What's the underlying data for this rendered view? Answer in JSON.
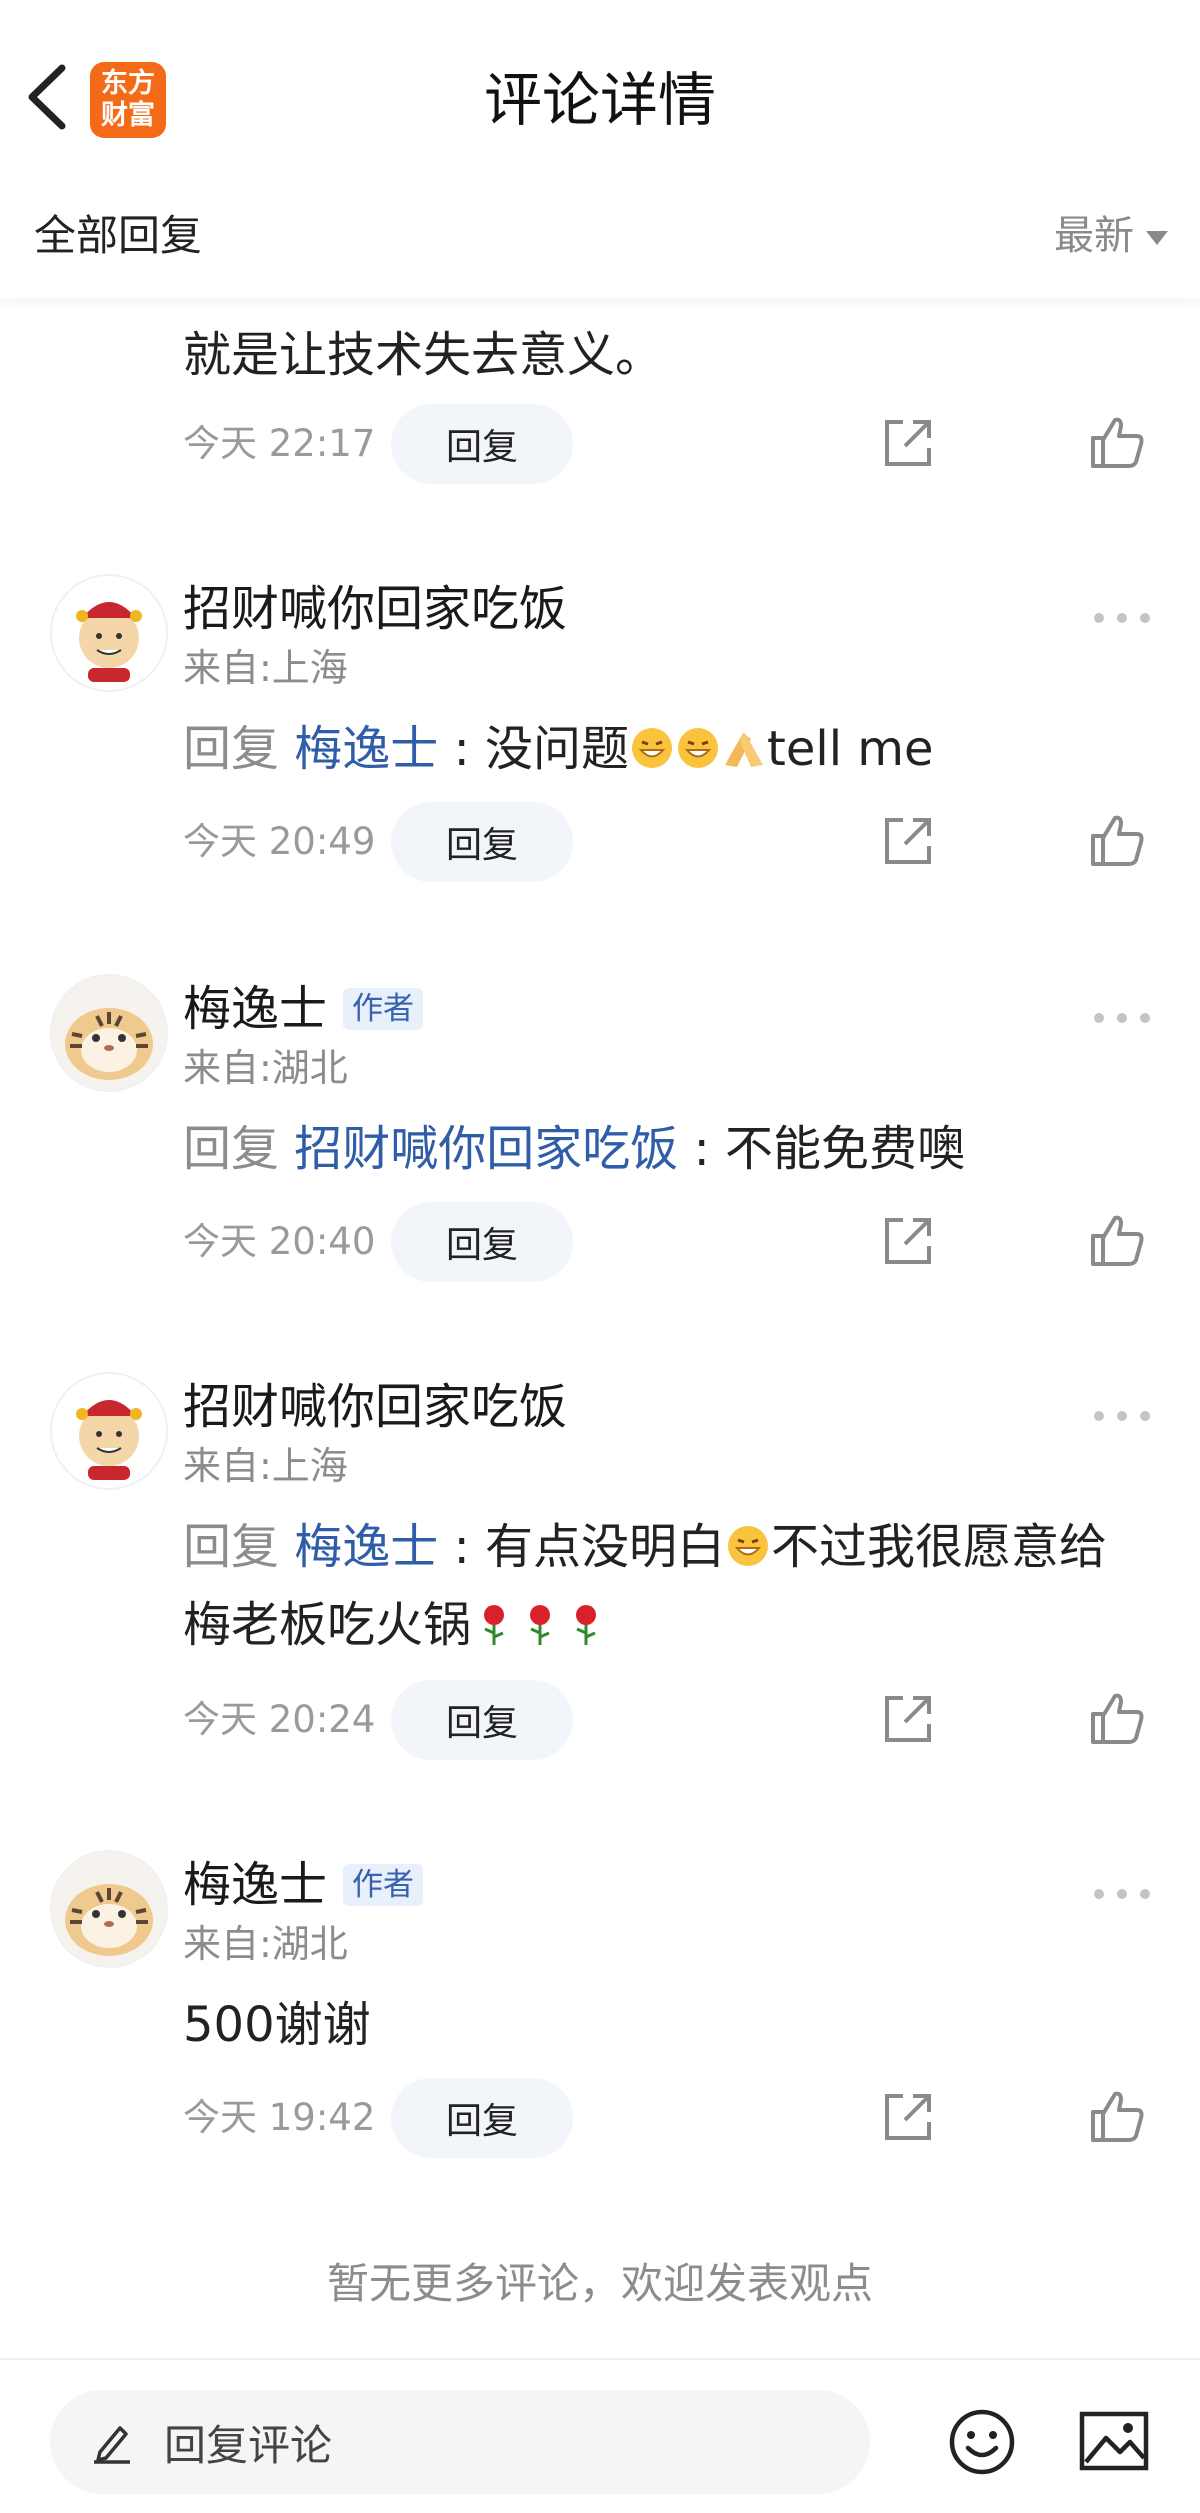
{
  "header": {
    "title": "评论详情",
    "logo_line1": "东方",
    "logo_line2": "财富"
  },
  "sortbar": {
    "label": "全部回复",
    "sort": "最新"
  },
  "partial_comment": {
    "text": "就是让技术失去意义。",
    "time": "今天 22:17",
    "reply": "回复"
  },
  "comments": [
    {
      "name": "招财喊你回家吃饭",
      "location": "来自:上海",
      "reply_prefix": "回复",
      "mention": "梅逸士",
      "text": ": 没问题",
      "text_after": "tell me",
      "time": "今天 20:49",
      "reply": "回复"
    },
    {
      "name": "梅逸士",
      "badge": "作者",
      "location": "来自:湖北",
      "reply_prefix": "回复",
      "mention": "招财喊你回家吃饭",
      "text": ": 不能免费噢",
      "time": "今天 20:40",
      "reply": "回复"
    },
    {
      "name": "招财喊你回家吃饭",
      "location": "来自:上海",
      "reply_prefix": "回复",
      "mention": "梅逸士",
      "text": ": 有点没明白",
      "text_mid": "不过我很愿意给",
      "text_line2": "梅老板吃火锅",
      "time": "今天 20:24",
      "reply": "回复"
    },
    {
      "name": "梅逸士",
      "badge": "作者",
      "location": "来自:湖北",
      "text": "500谢谢",
      "time": "今天 19:42",
      "reply": "回复"
    }
  ],
  "footer_note": "暂无更多评论，欢迎发表观点",
  "bottom": {
    "placeholder": "回复评论"
  },
  "icons": [
    "back-icon",
    "more-icon",
    "share-icon",
    "like-icon",
    "pen-icon",
    "emoji-icon",
    "image-icon",
    "grin-emoji",
    "pray-emoji",
    "rose-emoji"
  ],
  "colors": {
    "accent": "#2f5da8",
    "logo": "#f46a17",
    "badge_bg": "#e8f0fc"
  }
}
